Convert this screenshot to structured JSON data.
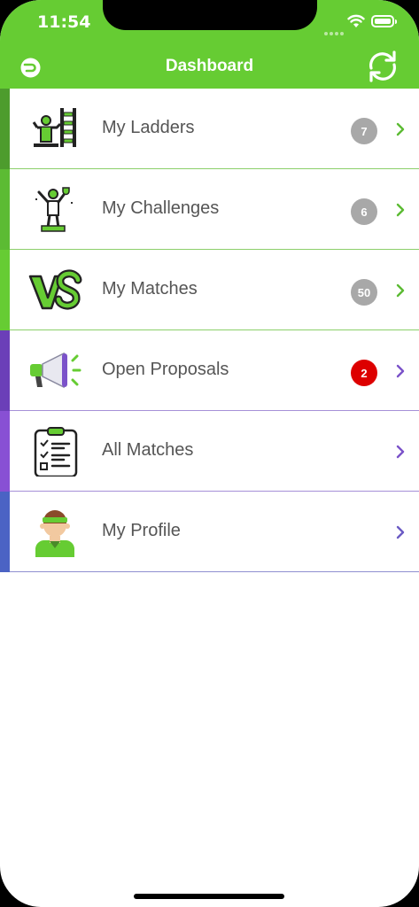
{
  "status_bar": {
    "time": "11:54"
  },
  "header": {
    "title": "Dashboard",
    "logo_icon": "logo-icon",
    "refresh_icon": "refresh-icon"
  },
  "colors": {
    "header_green": "#66cc33",
    "green_dark": "#4d9c2d",
    "green_mid": "#5cbb33",
    "green_light": "#66cc33",
    "purple_dark": "#6b3fb8",
    "purple_mid": "#8850d4",
    "blue": "#4b63c4",
    "badge_gray": "#a8a8a8",
    "badge_red": "#dd0000"
  },
  "menu": {
    "items": [
      {
        "label": "My Ladders",
        "badge": "7",
        "badge_color": "#a8a8a8",
        "bar_color": "#4d9c2d",
        "accent": "#5cbb33",
        "icon": "ladder-icon"
      },
      {
        "label": "My Challenges",
        "badge": "6",
        "badge_color": "#a8a8a8",
        "bar_color": "#5cbb33",
        "accent": "#5cbb33",
        "icon": "trophy-player-icon"
      },
      {
        "label": "My Matches",
        "badge": "50",
        "badge_color": "#a8a8a8",
        "bar_color": "#66cc33",
        "accent": "#5cbb33",
        "icon": "versus-icon"
      },
      {
        "label": "Open Proposals",
        "badge": "2",
        "badge_color": "#dd0000",
        "bar_color": "#6b3fb8",
        "accent": "#7b52c9",
        "icon": "megaphone-icon"
      },
      {
        "label": "All Matches",
        "badge": "",
        "badge_color": "",
        "bar_color": "#8850d4",
        "accent": "#7b52c9",
        "icon": "clipboard-icon"
      },
      {
        "label": "My Profile",
        "badge": "",
        "badge_color": "",
        "bar_color": "#4b63c4",
        "accent": "#6b5bc4",
        "icon": "avatar-icon"
      }
    ]
  }
}
